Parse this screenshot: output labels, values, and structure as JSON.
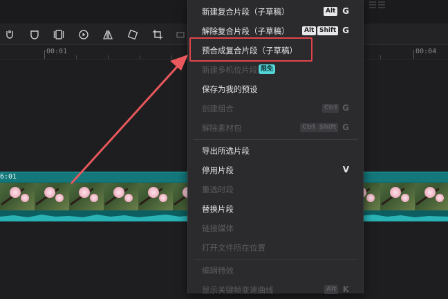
{
  "timeline": {
    "ruler": {
      "ticks": [
        "00:01",
        "00:04"
      ]
    },
    "track": {
      "time_label": "6:01"
    }
  },
  "toolbar": {
    "icons": [
      "freeze-icon",
      "shield-icon",
      "mirror-icon",
      "play-circle-icon",
      "flip-icon",
      "rotate-icon",
      "crop-icon",
      "more-icon"
    ]
  },
  "context_menu": {
    "items": [
      {
        "label": "新建复合片段（子草稿）",
        "keys": [
          "Alt"
        ],
        "letter": "G",
        "disabled": false
      },
      {
        "label": "解除复合片段（子草稿）",
        "keys": [
          "Alt",
          "Shift"
        ],
        "letter": "G",
        "disabled": false
      },
      {
        "label": "预合成复合片段（子草稿）",
        "keys": [],
        "letter": "",
        "disabled": false
      },
      {
        "label": "新建多机位片段",
        "badge": "限免",
        "keys": [],
        "letter": "",
        "disabled": true
      },
      {
        "label": "保存为我的预设",
        "keys": [],
        "letter": "",
        "disabled": false
      },
      {
        "label": "创建组合",
        "keys": [
          "Ctrl"
        ],
        "letter": "G",
        "disabled": true
      },
      {
        "label": "解除素材包",
        "keys": [
          "Ctrl",
          "Shift"
        ],
        "letter": "G",
        "disabled": true
      },
      {
        "label": "导出所选片段",
        "keys": [],
        "letter": "",
        "disabled": false
      },
      {
        "label": "停用片段",
        "keys": [],
        "letter": "V",
        "disabled": false
      },
      {
        "label": "重选时段",
        "keys": [],
        "letter": "",
        "disabled": true
      },
      {
        "label": "替换片段",
        "keys": [],
        "letter": "",
        "disabled": false
      },
      {
        "label": "链接媒体",
        "keys": [],
        "letter": "",
        "disabled": true
      },
      {
        "label": "打开文件所在位置",
        "keys": [],
        "letter": "",
        "disabled": true
      },
      {
        "label": "编辑特效",
        "keys": [],
        "letter": "",
        "disabled": true
      },
      {
        "label": "显示关键帧变速曲线",
        "keys": [
          "Alt"
        ],
        "letter": "K",
        "disabled": true
      }
    ]
  },
  "annotation": {
    "highlight_color": "#e0454b",
    "arrow_color": "#e9585c"
  }
}
